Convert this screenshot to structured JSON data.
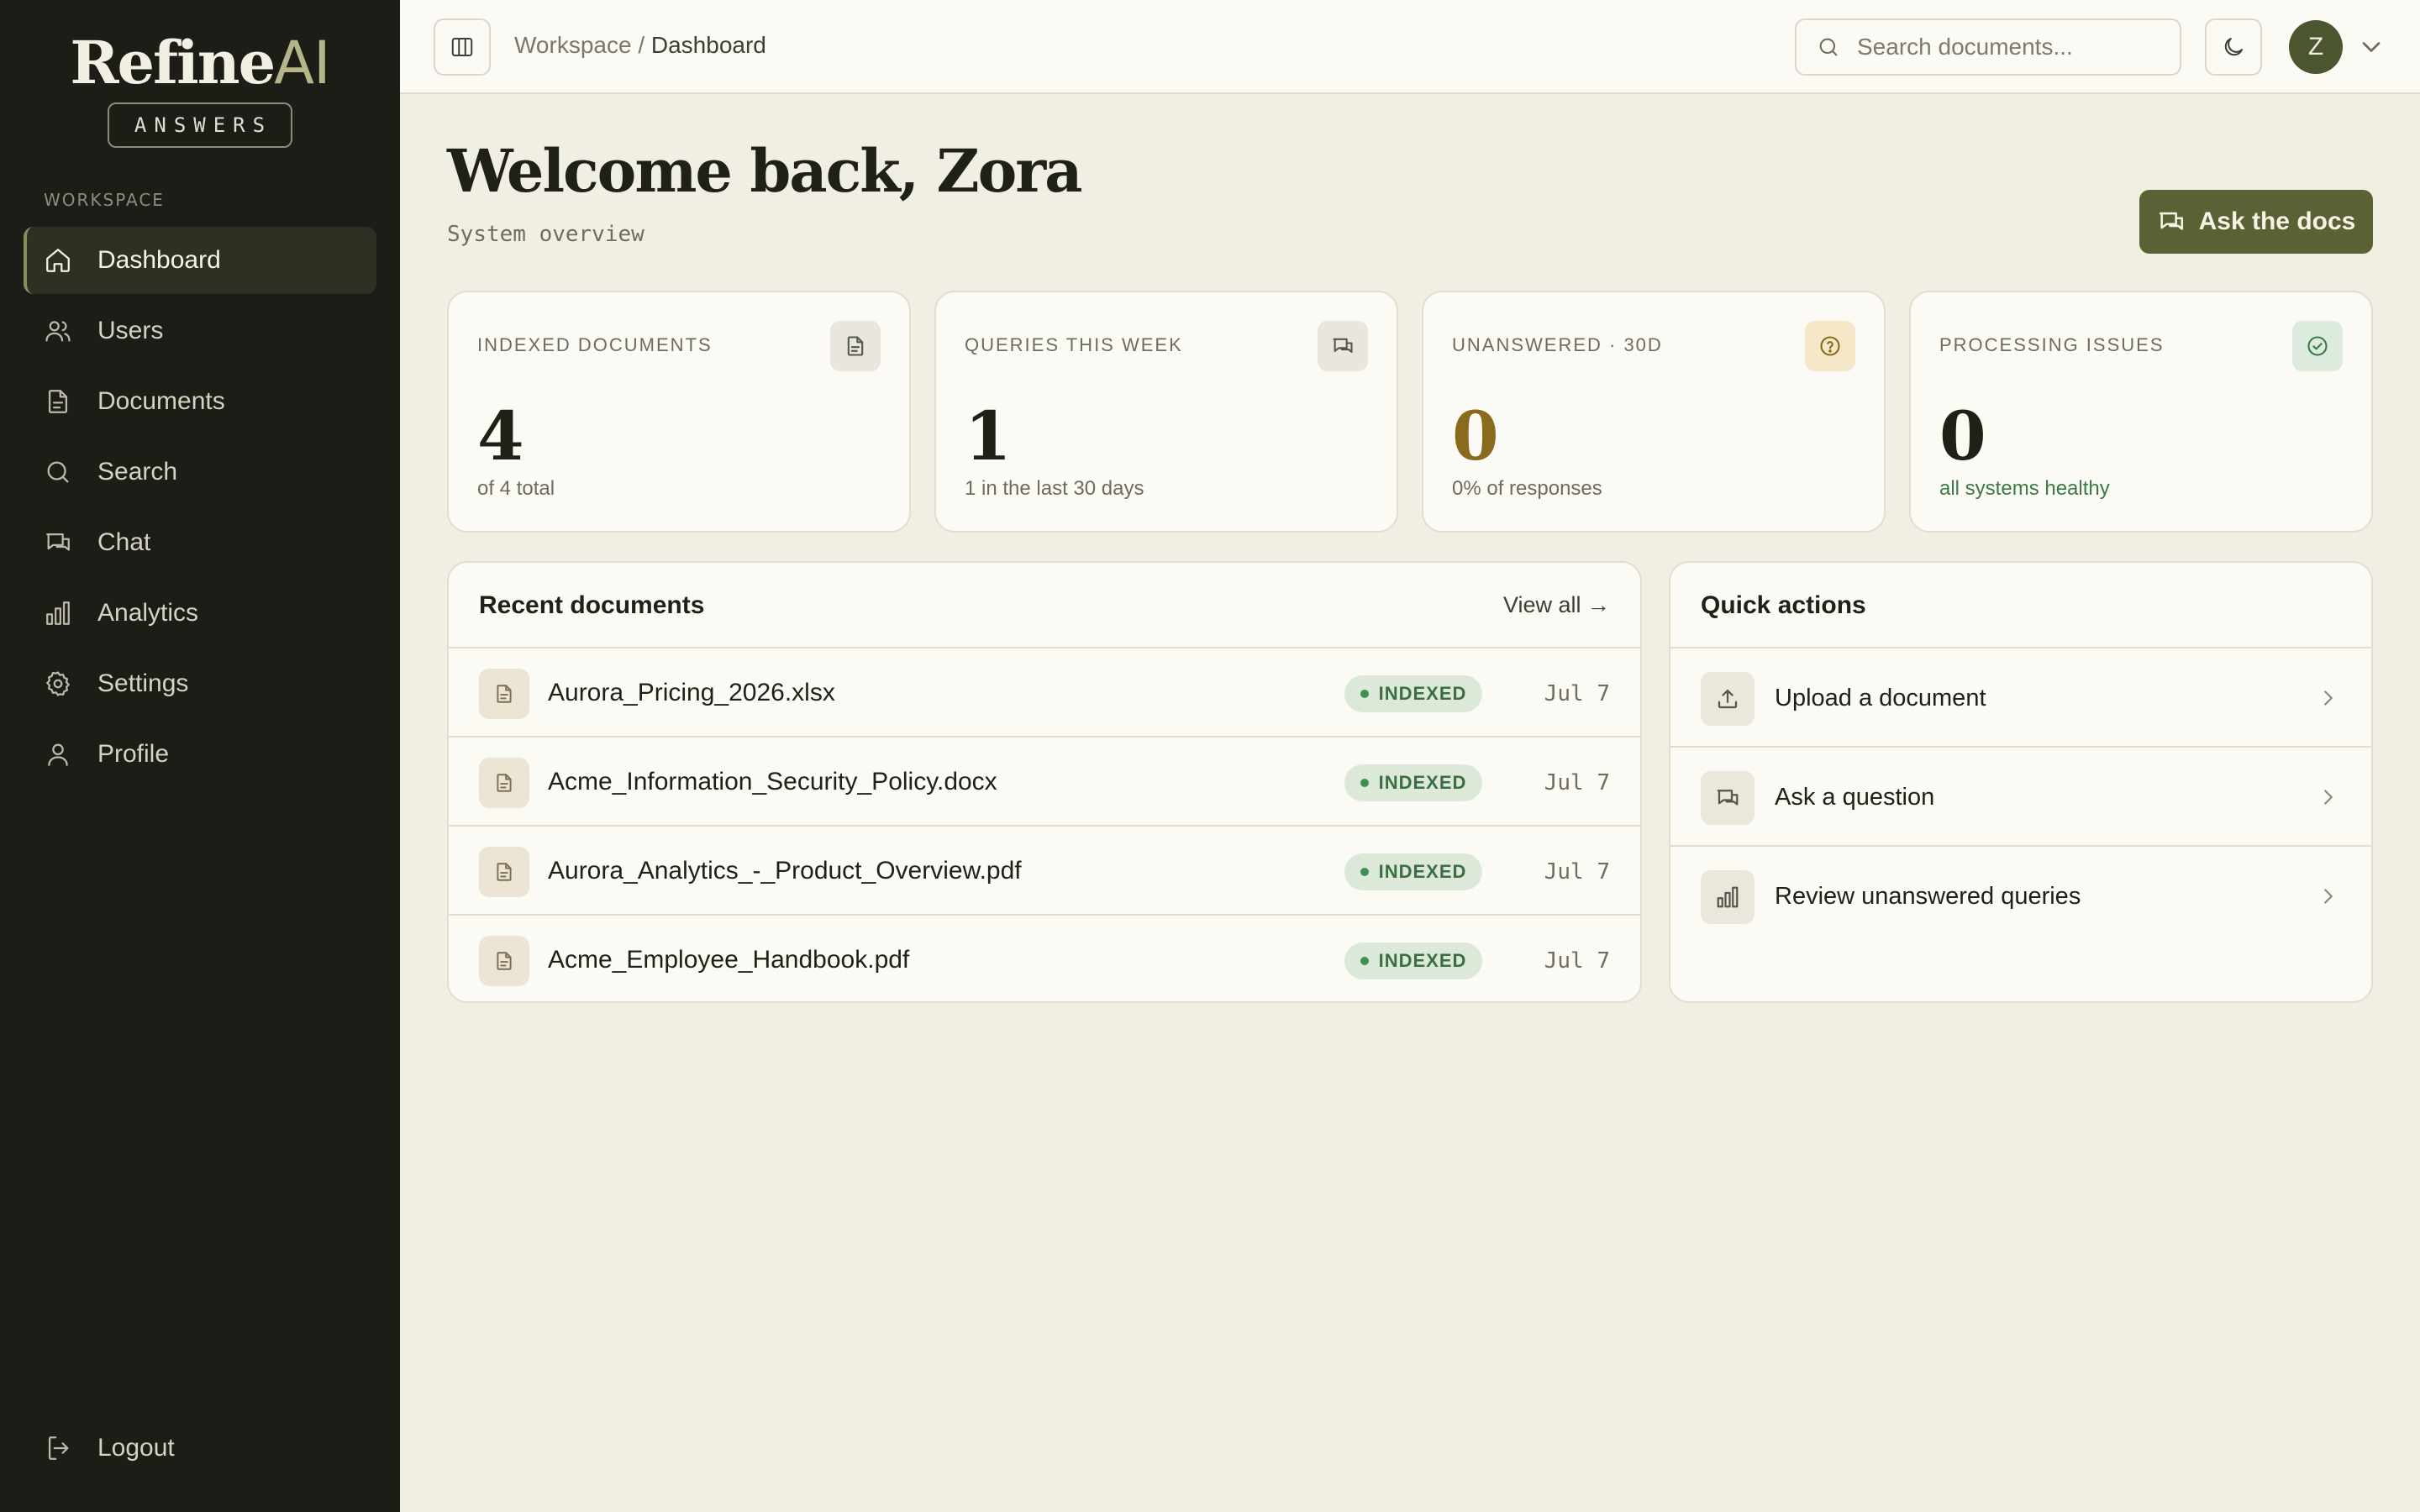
{
  "brand": {
    "name": "Refine",
    "suffix": "AI",
    "badge": "ANSWERS"
  },
  "sidebar": {
    "section_label": "WORKSPACE",
    "items": [
      {
        "label": "Dashboard",
        "icon": "home-icon",
        "active": true
      },
      {
        "label": "Users",
        "icon": "users-icon"
      },
      {
        "label": "Documents",
        "icon": "document-icon"
      },
      {
        "label": "Search",
        "icon": "search-icon"
      },
      {
        "label": "Chat",
        "icon": "chat-icon"
      },
      {
        "label": "Analytics",
        "icon": "bar-chart-icon"
      },
      {
        "label": "Settings",
        "icon": "gear-icon"
      },
      {
        "label": "Profile",
        "icon": "user-icon"
      }
    ],
    "logout_label": "Logout"
  },
  "topbar": {
    "breadcrumb_root": "Workspace",
    "breadcrumb_sep": " / ",
    "breadcrumb_current": "Dashboard",
    "search_placeholder": "Search documents...",
    "avatar_initial": "Z"
  },
  "header": {
    "title": "Welcome back, Zora",
    "subtitle": "System overview",
    "ask_button": "Ask the docs"
  },
  "stats": [
    {
      "label": "INDEXED DOCUMENTS",
      "value": "4",
      "note": "of 4 total",
      "icon": "document-icon"
    },
    {
      "label": "QUERIES THIS WEEK",
      "value": "1",
      "note": "1 in the last 30 days",
      "icon": "chat-icon"
    },
    {
      "label": "UNANSWERED · 30D",
      "value": "0",
      "note": "0% of responses",
      "icon": "question-icon"
    },
    {
      "label": "PROCESSING ISSUES",
      "value": "0",
      "note": "all systems healthy",
      "icon": "check-circle-icon"
    }
  ],
  "recent_documents": {
    "title": "Recent documents",
    "view_all": "View all →",
    "rows": [
      {
        "name": "Aurora_Pricing_2026.xlsx",
        "status": "INDEXED",
        "date": "Jul 7"
      },
      {
        "name": "Acme_Information_Security_Policy.docx",
        "status": "INDEXED",
        "date": "Jul 7"
      },
      {
        "name": "Aurora_Analytics_-_Product_Overview.pdf",
        "status": "INDEXED",
        "date": "Jul 7"
      },
      {
        "name": "Acme_Employee_Handbook.pdf",
        "status": "INDEXED",
        "date": "Jul 7"
      }
    ]
  },
  "quick_actions": {
    "title": "Quick actions",
    "items": [
      {
        "label": "Upload a document",
        "icon": "upload-icon"
      },
      {
        "label": "Ask a question",
        "icon": "chat-icon"
      },
      {
        "label": "Review unanswered queries",
        "icon": "bar-chart-icon"
      }
    ]
  },
  "colors": {
    "sidebar_bg": "#1c1d17",
    "page_bg": "#f1eee3",
    "accent": "#5a6235",
    "unanswered_value": "#8a6a1c",
    "healthy_text": "#3a7a45",
    "indexed_badge_bg": "#dde9d8"
  }
}
